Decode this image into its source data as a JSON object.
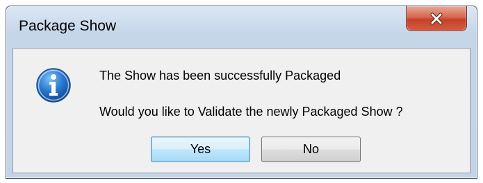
{
  "dialog": {
    "title": "Package Show",
    "close_icon": "close-icon",
    "info_icon": "info-icon",
    "message_line1": "The Show has been successfully Packaged",
    "message_line2": "Would you like to Validate the newly Packaged Show ?",
    "buttons": {
      "yes_label": "Yes",
      "no_label": "No"
    }
  },
  "colors": {
    "close_button": "#c4412a",
    "default_button_border": "#3c7fb1",
    "info_icon_blue": "#1a5fb4"
  }
}
